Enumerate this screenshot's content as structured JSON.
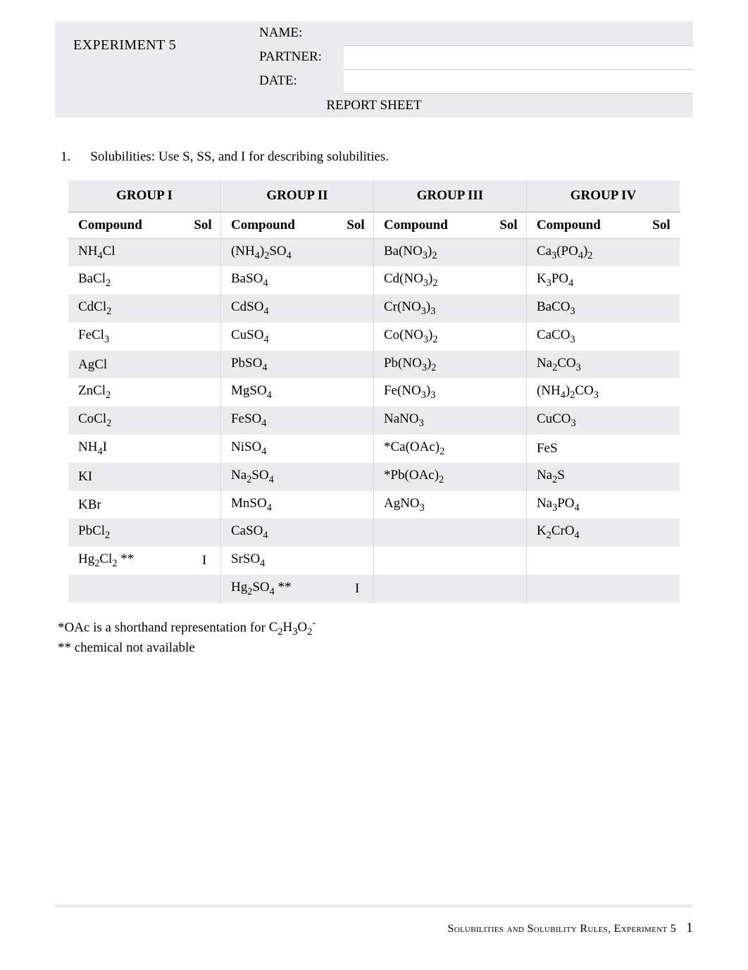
{
  "header": {
    "experiment": "EXPERIMENT  5",
    "name_label": "NAME:",
    "partner_label": "PARTNER:",
    "date_label": "DATE:",
    "report_title": "REPORT SHEET"
  },
  "question": {
    "number": "1.",
    "text": "Solubilities:   Use S, SS, and I for describing solubilities."
  },
  "table_headers": {
    "g1": "GROUP I",
    "g2": "GROUP II",
    "g3": "GROUP III",
    "g4": "GROUP IV",
    "compound": "Compound",
    "sol": "Sol"
  },
  "rows": [
    {
      "g1c": "NH₄Cl",
      "g1s": "",
      "g2c": "(NH₄)₂SO₄",
      "g2s": "",
      "g3c": "Ba(NO₃)₂",
      "g3s": "",
      "g4c": "Ca₃(PO₄)₂",
      "g4s": ""
    },
    {
      "g1c": "BaCl₂",
      "g1s": "",
      "g2c": "BaSO₄",
      "g2s": "",
      "g3c": "Cd(NO₃)₂",
      "g3s": "",
      "g4c": "K₃PO₄",
      "g4s": ""
    },
    {
      "g1c": "CdCl₂",
      "g1s": "",
      "g2c": "CdSO₄",
      "g2s": "",
      "g3c": "Cr(NO₃)₃",
      "g3s": "",
      "g4c": "BaCO₃",
      "g4s": ""
    },
    {
      "g1c": "FeCl₃",
      "g1s": "",
      "g2c": "CuSO₄",
      "g2s": "",
      "g3c": "Co(NO₃)₂",
      "g3s": "",
      "g4c": "CaCO₃",
      "g4s": ""
    },
    {
      "g1c": "AgCl",
      "g1s": "",
      "g2c": "PbSO₄",
      "g2s": "",
      "g3c": "Pb(NO₃)₂",
      "g3s": "",
      "g4c": "Na₂CO₃",
      "g4s": ""
    },
    {
      "g1c": "ZnCl₂",
      "g1s": "",
      "g2c": "MgSO₄",
      "g2s": "",
      "g3c": "Fe(NO₃)₃",
      "g3s": "",
      "g4c": "(NH₄)₂CO₃",
      "g4s": ""
    },
    {
      "g1c": "CoCl₂",
      "g1s": "",
      "g2c": "FeSO₄",
      "g2s": "",
      "g3c": "NaNO₃",
      "g3s": "",
      "g4c": "CuCO₃",
      "g4s": ""
    },
    {
      "g1c": "NH₄I",
      "g1s": "",
      "g2c": "NiSO₄",
      "g2s": "",
      "g3c": "*Ca(OAc)₂",
      "g3s": "",
      "g4c": "FeS",
      "g4s": ""
    },
    {
      "g1c": "KI",
      "g1s": "",
      "g2c": "Na₂SO₄",
      "g2s": "",
      "g3c": "*Pb(OAc)₂",
      "g3s": "",
      "g4c": "Na₂S",
      "g4s": ""
    },
    {
      "g1c": "KBr",
      "g1s": "",
      "g2c": "MnSO₄",
      "g2s": "",
      "g3c": "AgNO₃",
      "g3s": "",
      "g4c": "Na₃PO₄",
      "g4s": ""
    },
    {
      "g1c": "PbCl₂",
      "g1s": "",
      "g2c": "CaSO₄",
      "g2s": "",
      "g3c": "",
      "g3s": "",
      "g4c": "K₂CrO₄",
      "g4s": ""
    },
    {
      "g1c": "Hg₂Cl₂  **",
      "g1s": "I",
      "g2c": "SrSO₄",
      "g2s": "",
      "g3c": "",
      "g3s": "",
      "g4c": "",
      "g4s": ""
    },
    {
      "g1c": "",
      "g1s": "",
      "g2c": "Hg₂SO₄ **",
      "g2s": "I",
      "g3c": "",
      "g3s": "",
      "g4c": "",
      "g4s": ""
    }
  ],
  "footnotes": {
    "line1_prefix": "*OAc is a shorthand representation for ",
    "line1_formula": "C₂H₃O₂⁻",
    "line2": "** chemical not available"
  },
  "footer": {
    "text": "Solubilities and Solubility Rules, Experiment 5",
    "page": "1"
  }
}
